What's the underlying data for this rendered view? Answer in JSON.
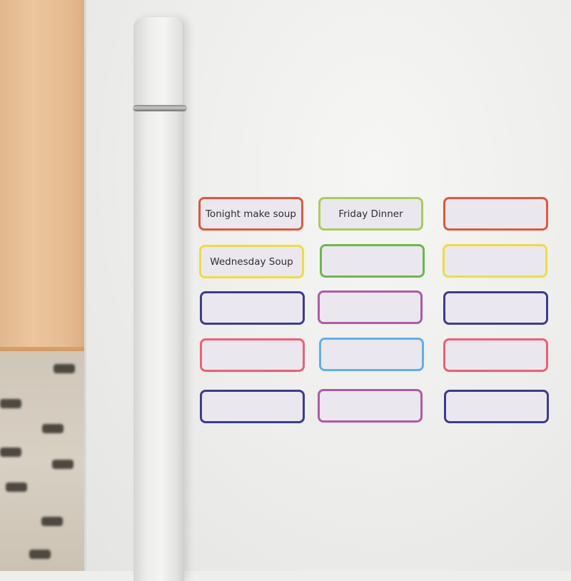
{
  "scene": {
    "description": "Magnetic dry-erase labels on a white refrigerator door",
    "background_colors": {
      "wood": "#e6bb90",
      "fridge": "#eeeeec",
      "handle": "#ececea",
      "label_fill": "#eae8ee",
      "text": "#2e2e2e"
    }
  },
  "labels": [
    {
      "row": 1,
      "col": 1,
      "text": "Tonight make soup",
      "border": "#e0583c"
    },
    {
      "row": 1,
      "col": 2,
      "text": "Friday Dinner",
      "border": "#a8cc5a"
    },
    {
      "row": 1,
      "col": 3,
      "text": "",
      "border": "#e0583c"
    },
    {
      "row": 2,
      "col": 1,
      "text": "Wednesday Soup",
      "border": "#f0dc3c"
    },
    {
      "row": 2,
      "col": 2,
      "text": "",
      "border": "#6cb84c"
    },
    {
      "row": 2,
      "col": 3,
      "text": "",
      "border": "#f0dc3c"
    },
    {
      "row": 3,
      "col": 1,
      "text": "",
      "border": "#3e3a94"
    },
    {
      "row": 3,
      "col": 2,
      "text": "",
      "border": "#b05aa8"
    },
    {
      "row": 3,
      "col": 3,
      "text": "",
      "border": "#3e3a94"
    },
    {
      "row": 4,
      "col": 1,
      "text": "",
      "border": "#ee6072"
    },
    {
      "row": 4,
      "col": 2,
      "text": "",
      "border": "#5cb0ee"
    },
    {
      "row": 4,
      "col": 3,
      "text": "",
      "border": "#ee6072"
    },
    {
      "row": 5,
      "col": 1,
      "text": "",
      "border": "#3e3a94"
    },
    {
      "row": 5,
      "col": 2,
      "text": "",
      "border": "#b05aa8"
    },
    {
      "row": 5,
      "col": 3,
      "text": "",
      "border": "#3e3a94"
    }
  ]
}
